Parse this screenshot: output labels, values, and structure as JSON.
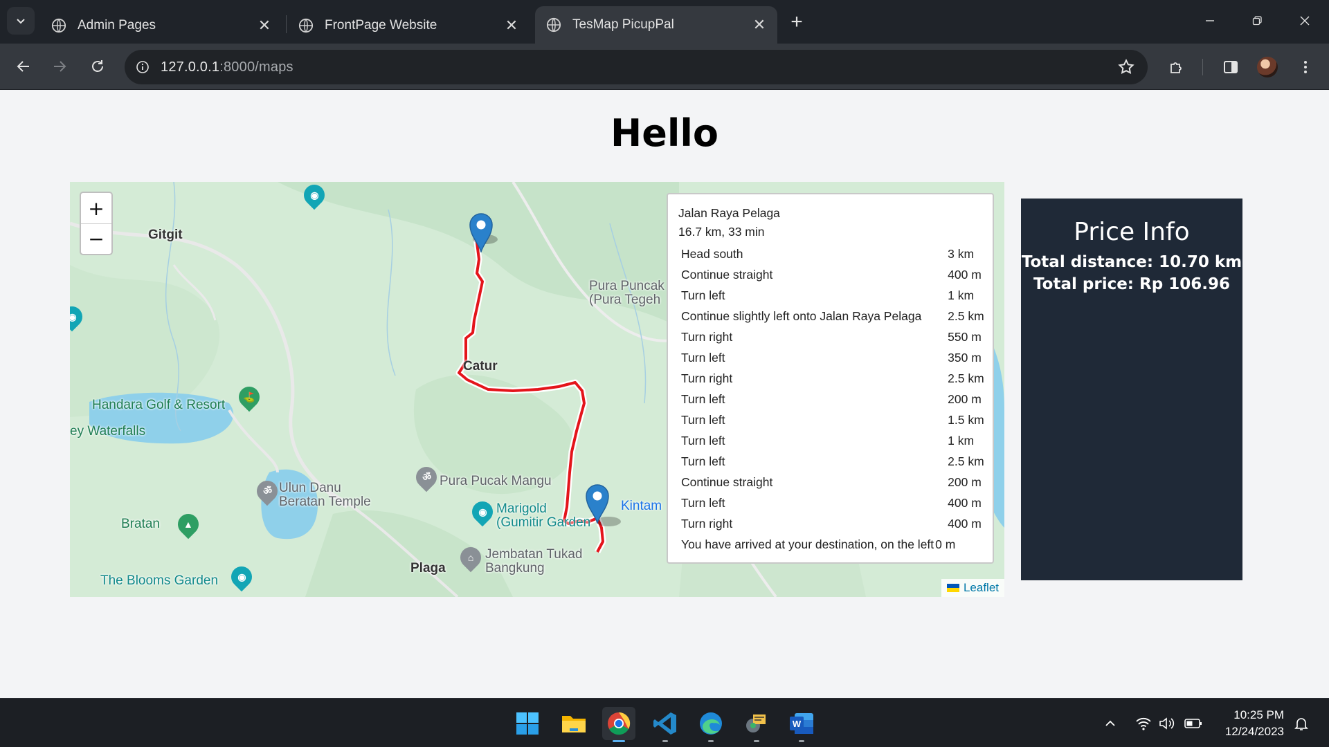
{
  "browser": {
    "tabs": [
      {
        "title": "Admin Pages",
        "active": false
      },
      {
        "title": "FrontPage Website",
        "active": false
      },
      {
        "title": "TesMap PicupPal",
        "active": true
      }
    ],
    "url_host": "127.0.0.1",
    "url_rest": ":8000/maps"
  },
  "page": {
    "heading": "Hello"
  },
  "map": {
    "labels": {
      "gitgit": "Gitgit",
      "pura_puncak": "Pura Puncak",
      "pura_tegeh": "(Pura Tegeh",
      "catur": "Catur",
      "handara": "Handara Golf & Resort",
      "waterfalls": "ey Waterfalls",
      "pura_pucak_mangu": "Pura Pucak Mangu",
      "ulun_danu": "Ulun Danu",
      "beratan_temple": "Beratan Temple",
      "marigold": "Marigold",
      "gumitir": "(Gumitir Garden",
      "kintamani": "Kintam",
      "bratan": "Bratan",
      "jembatan": "Jembatan Tukad",
      "bangkung": "Bangkung",
      "plaga": "Plaga",
      "blooms": "The Blooms Garden"
    },
    "zoom_in": "+",
    "zoom_out": "−",
    "attribution": "Leaflet",
    "route": {
      "name": "Jalan Raya Pelaga",
      "summary": "16.7 km, 33 min",
      "steps": [
        {
          "text": "Head south",
          "distance": "3 km"
        },
        {
          "text": "Continue straight",
          "distance": "400 m"
        },
        {
          "text": "Turn left",
          "distance": "1 km"
        },
        {
          "text": "Continue slightly left onto Jalan Raya Pelaga",
          "distance": "2.5 km"
        },
        {
          "text": "Turn right",
          "distance": "550 m"
        },
        {
          "text": "Turn left",
          "distance": "350 m"
        },
        {
          "text": "Turn right",
          "distance": "2.5 km"
        },
        {
          "text": "Turn left",
          "distance": "200 m"
        },
        {
          "text": "Turn left",
          "distance": "1.5 km"
        },
        {
          "text": "Turn left",
          "distance": "1 km"
        },
        {
          "text": "Turn left",
          "distance": "2.5 km"
        },
        {
          "text": "Continue straight",
          "distance": "200 m"
        },
        {
          "text": "Turn left",
          "distance": "400 m"
        },
        {
          "text": "Turn right",
          "distance": "400 m"
        },
        {
          "text": "You have arrived at your destination, on the left",
          "distance": "0 m"
        }
      ]
    }
  },
  "price_info": {
    "title": "Price Info",
    "distance": "Total distance: 10.70 km",
    "price": "Total price: Rp 106.96"
  },
  "taskbar": {
    "time": "10:25 PM",
    "date": "12/24/2023"
  },
  "colors": {
    "route": "#e4141b",
    "marker": "#2a81cb",
    "price_panel": "#1f2937",
    "chrome_dark": "#1f2329",
    "chrome_toolbar": "#35393f"
  }
}
